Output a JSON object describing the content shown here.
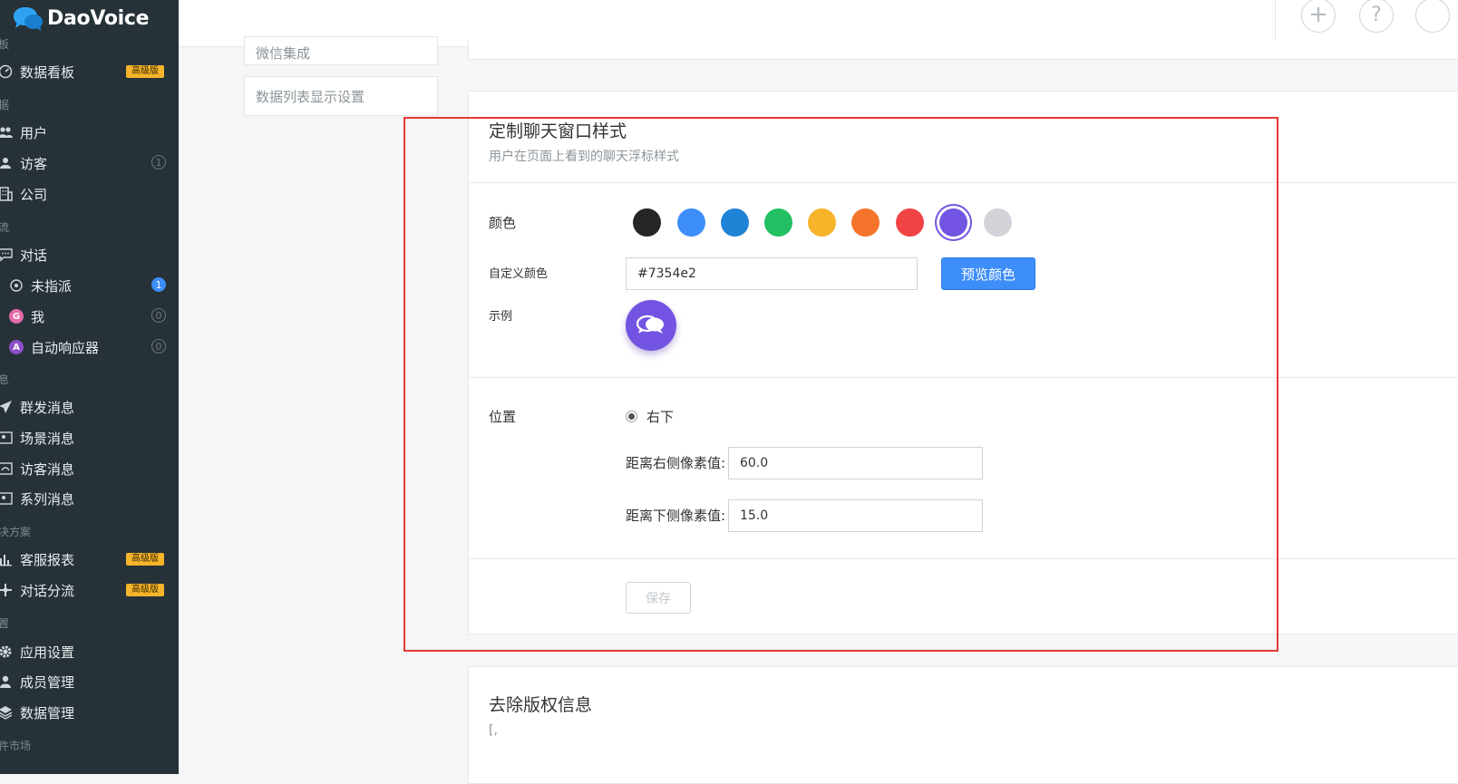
{
  "brand": {
    "name": "DaoVoice"
  },
  "sidebar": {
    "sections": [
      "板",
      "据",
      "流",
      "息",
      "决方案",
      "置",
      "件市场"
    ],
    "items": [
      {
        "label": "数据看板",
        "badge": "高级版"
      },
      {
        "label": "用户"
      },
      {
        "label": "访客",
        "count": "1"
      },
      {
        "label": "公司"
      },
      {
        "label": "对话"
      },
      {
        "label": "未指派",
        "count": "1"
      },
      {
        "label": "我",
        "count": "0",
        "avatar": "G"
      },
      {
        "label": "自动响应器",
        "count": "0",
        "avatar": "A"
      },
      {
        "label": "群发消息"
      },
      {
        "label": "场景消息"
      },
      {
        "label": "访客消息"
      },
      {
        "label": "系列消息"
      },
      {
        "label": "客服报表",
        "badge": "高级版"
      },
      {
        "label": "对话分流",
        "badge": "高级版"
      },
      {
        "label": "应用设置"
      },
      {
        "label": "成员管理"
      },
      {
        "label": "数据管理"
      }
    ]
  },
  "topbar": {
    "add_icon": "+",
    "help_icon": "?"
  },
  "subnav": {
    "items": [
      "微信集成",
      "数据列表显示设置"
    ]
  },
  "chat_style": {
    "title": "定制聊天窗口样式",
    "subtitle": "用户在页面上看到的聊天浮标样式",
    "color_label": "颜色",
    "colors": [
      "#262626",
      "#3d8ef8",
      "#1f83d6",
      "#22c063",
      "#f6b42a",
      "#f5742b",
      "#f04444",
      "#7354e2",
      "#d2d4d9"
    ],
    "selected_color": "#7354e2",
    "custom_color_label": "自定义颜色",
    "custom_color_value": "#7354e2",
    "preview_button": "预览颜色",
    "example_label": "示例",
    "position_label": "位置",
    "position_option": "右下",
    "right_offset_label": "距离右侧像素值:",
    "right_offset_value": "60.0",
    "bottom_offset_label": "距离下侧像素值:",
    "bottom_offset_value": "15.0",
    "save_button": "保存"
  },
  "copyright": {
    "title": "去除版权信息",
    "snippet": "[,"
  }
}
